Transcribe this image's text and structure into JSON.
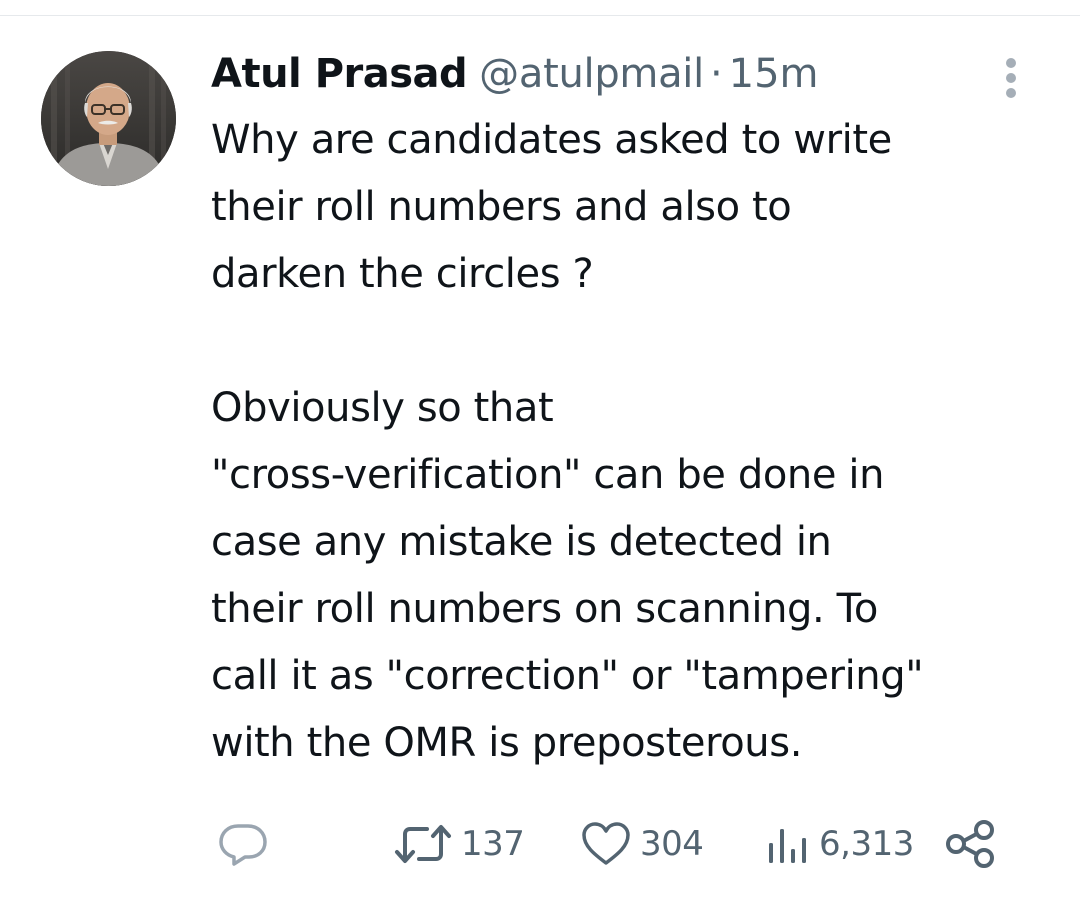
{
  "tweet": {
    "author": {
      "display_name": "Atul Prasad",
      "handle": "@atulpmail",
      "avatar": "profile-photo"
    },
    "separator": "·",
    "timestamp": "15m",
    "more_icon": "more-vertical-icon",
    "text": {
      "paragraph_1": [
        "Why are candidates asked to write",
        "their roll numbers and also to",
        "darken the circles ?"
      ],
      "paragraph_2": [
        "Obviously so that",
        "\"cross-verification\" can be done in",
        "case any mistake is detected in",
        "their roll numbers on scanning. To",
        "call it as \"correction\" or \"tampering\"",
        "with the OMR is preposterous."
      ]
    },
    "actions": {
      "reply": {
        "icon": "reply-icon",
        "count": ""
      },
      "retweet": {
        "icon": "retweet-icon",
        "count": "137"
      },
      "like": {
        "icon": "heart-icon",
        "count": "304"
      },
      "views": {
        "icon": "views-icon",
        "count": "6,313"
      },
      "share": {
        "icon": "share-icon"
      }
    }
  },
  "colors": {
    "text_primary": "#0f1419",
    "text_secondary": "#536471",
    "divider": "#e6e9ec",
    "more_dots": "#a5aeb7"
  }
}
